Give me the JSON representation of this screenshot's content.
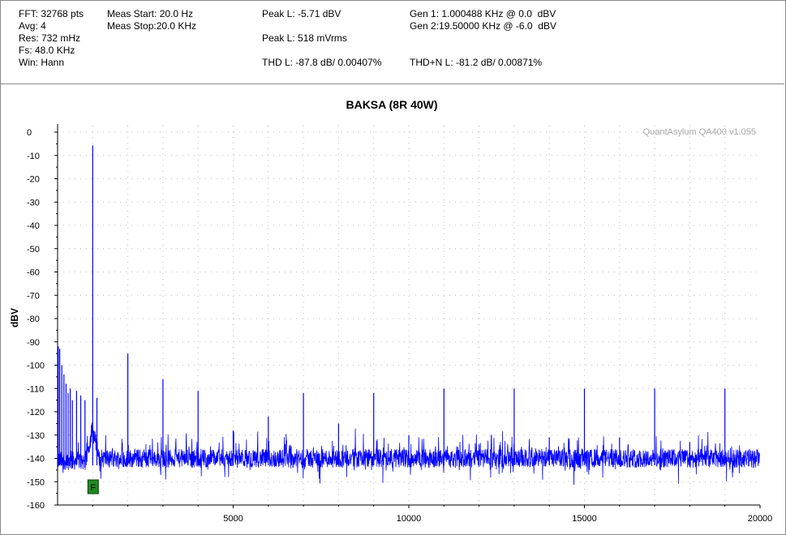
{
  "header": {
    "col1": [
      "FFT: 32768 pts",
      "Avg: 4",
      "Res: 732 mHz",
      "Fs: 48.0 KHz",
      "Win: Hann"
    ],
    "col2": [
      "Meas Start: 20.0 Hz",
      "Meas Stop:20.0 KHz"
    ],
    "peak_l_dbv": "Peak L: -5.71 dBV",
    "peak_l_mvrms": "Peak L: 518 mVrms",
    "thd_l": "THD L: -87.8 dB/ 0.00407%",
    "gen1": "Gen 1: 1.000488 KHz @ 0.0  dBV",
    "gen2": "Gen 2:19.50000 KHz @ -6.0  dBV",
    "thdn_l": "THD+N L: -81.2 dB/ 0.00871%"
  },
  "marker_label": "F",
  "colors": {
    "trace": "#0000ff",
    "marker_fill": "#1f8a1f",
    "watermark": "#a8a8a8",
    "grid": "#bdbdbd"
  },
  "chart_data": {
    "type": "line",
    "title": "BAKSA (8R 40W)",
    "watermark": "QuantAsylum QA400 v1.055",
    "xlabel": "",
    "ylabel": "dBV",
    "xlim": [
      0,
      20000
    ],
    "ylim": [
      -160,
      0
    ],
    "x_ticks": [
      5000,
      10000,
      15000,
      20000
    ],
    "x_tick_labels": [
      "5000",
      "10000",
      "15000",
      "20000"
    ],
    "y_ticks": [
      0,
      -10,
      -20,
      -30,
      -40,
      -50,
      -60,
      -70,
      -80,
      -90,
      -100,
      -110,
      -120,
      -130,
      -140,
      -150,
      -160
    ],
    "y_tick_labels": [
      "0",
      "-10",
      "-20",
      "-30",
      "-40",
      "-50",
      "-60",
      "-70",
      "-80",
      "-90",
      "-100",
      "-110",
      "-120",
      "-130",
      "-140",
      "-150",
      "-160"
    ],
    "grid": true,
    "noise_floor_dbv": -140,
    "peaks": [
      {
        "x": 20,
        "y": -92
      },
      {
        "x": 60,
        "y": -93
      },
      {
        "x": 120,
        "y": -100
      },
      {
        "x": 180,
        "y": -104
      },
      {
        "x": 240,
        "y": -108
      },
      {
        "x": 300,
        "y": -112
      },
      {
        "x": 360,
        "y": -110
      },
      {
        "x": 420,
        "y": -115
      },
      {
        "x": 540,
        "y": -111
      },
      {
        "x": 660,
        "y": -113
      },
      {
        "x": 780,
        "y": -115
      },
      {
        "x": 1000,
        "y": -5.7
      },
      {
        "x": 1120,
        "y": -114
      },
      {
        "x": 2000,
        "y": -95
      },
      {
        "x": 3000,
        "y": -106
      },
      {
        "x": 4000,
        "y": -111
      },
      {
        "x": 5000,
        "y": -128
      },
      {
        "x": 6000,
        "y": -122
      },
      {
        "x": 7000,
        "y": -112
      },
      {
        "x": 8000,
        "y": -125
      },
      {
        "x": 9000,
        "y": -112
      },
      {
        "x": 10000,
        "y": -130
      },
      {
        "x": 11000,
        "y": -110
      },
      {
        "x": 12000,
        "y": -134
      },
      {
        "x": 13000,
        "y": -110
      },
      {
        "x": 14000,
        "y": -131
      },
      {
        "x": 15000,
        "y": -110
      },
      {
        "x": 16000,
        "y": -131
      },
      {
        "x": 17000,
        "y": -110
      },
      {
        "x": 18000,
        "y": -133
      },
      {
        "x": 19000,
        "y": -110
      }
    ],
    "marker": {
      "x": 1000,
      "y": -152
    }
  }
}
